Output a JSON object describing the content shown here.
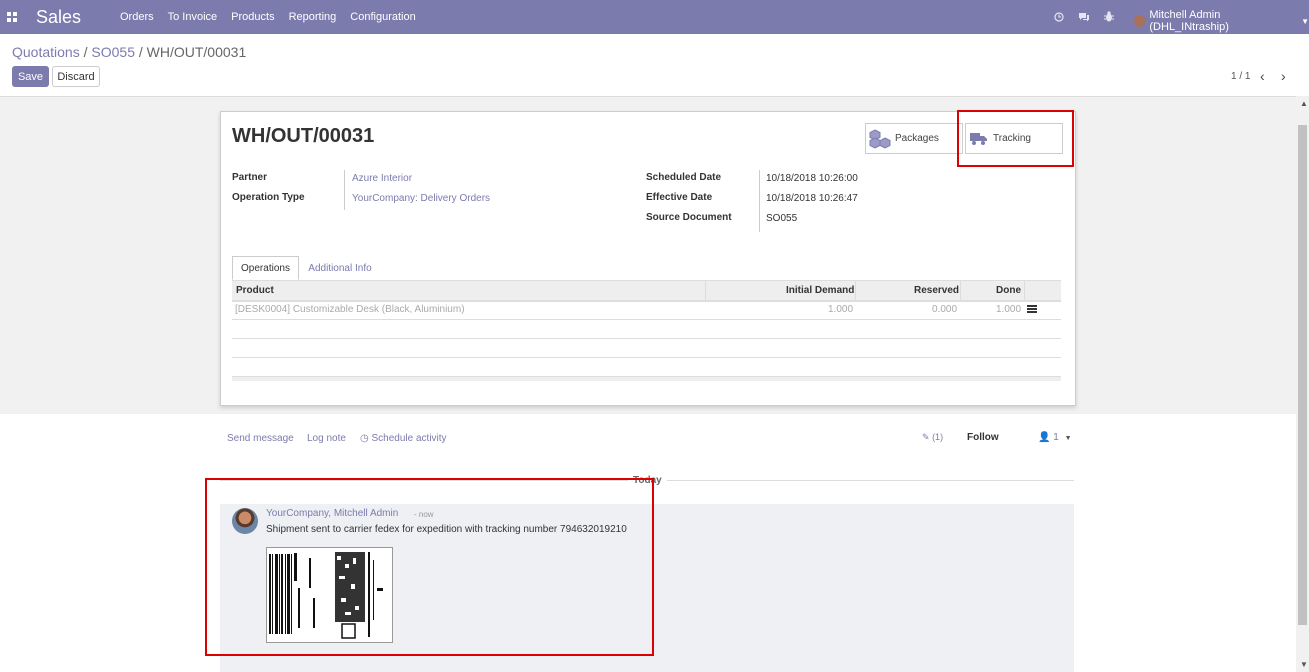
{
  "app": {
    "brand": "Sales"
  },
  "nav": {
    "menu": [
      "Orders",
      "To Invoice",
      "Products",
      "Reporting",
      "Configuration"
    ],
    "user": "Mitchell Admin (DHL_INtraship)"
  },
  "breadcrumb": {
    "first": "Quotations",
    "second": "SO055",
    "current": "WH/OUT/00031",
    "sep": "/"
  },
  "buttons": {
    "save": "Save",
    "discard": "Discard"
  },
  "pager": {
    "value": "1 / 1"
  },
  "record": {
    "title": "WH/OUT/00031",
    "stat_buttons": {
      "packages": "Packages",
      "tracking": "Tracking"
    },
    "fields": {
      "partner_label": "Partner",
      "partner": "Azure Interior",
      "operation_type_label": "Operation Type",
      "operation_type": "YourCompany: Delivery Orders",
      "scheduled_date_label": "Scheduled Date",
      "scheduled_date": "10/18/2018 10:26:00",
      "effective_date_label": "Effective Date",
      "effective_date": "10/18/2018 10:26:47",
      "source_document_label": "Source Document",
      "source_document": "SO055"
    },
    "tabs": [
      "Operations",
      "Additional Info"
    ],
    "table": {
      "columns": [
        "Product",
        "Initial Demand",
        "Reserved",
        "Done"
      ],
      "rows": [
        {
          "product": "[DESK0004] Customizable Desk (Black, Aluminium)",
          "initial_demand": "1.000",
          "reserved": "0.000",
          "done": "1.000"
        }
      ]
    }
  },
  "chatter": {
    "send_message": "Send message",
    "log_note": "Log note",
    "schedule_activity": "Schedule activity",
    "attachments": "(1)",
    "follow": "Follow",
    "followers": "1",
    "date_separator": "Today",
    "message": {
      "author": "YourCompany, Mitchell Admin",
      "time": "- now",
      "body": "Shipment sent to carrier fedex for expedition with tracking number 794632019210"
    }
  },
  "colors": {
    "brand": "#7c7bad",
    "highlight": "#dd0000"
  }
}
